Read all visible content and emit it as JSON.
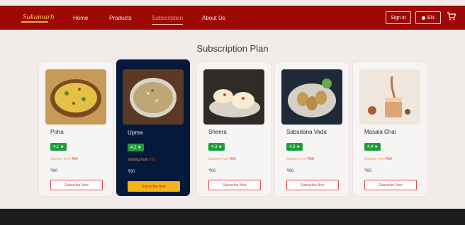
{
  "nav": {
    "logo": "Sukamarh",
    "links": [
      "Home",
      "Products",
      "Subscription",
      "About Us"
    ],
    "signin": "Sign in",
    "lang": "EN"
  },
  "title": "Subscription Plan",
  "plans": [
    {
      "name": "Poha",
      "rating": "4.1 ★",
      "starting": "Starting from",
      "price": "₹50",
      "old": "₹80",
      "button": "Subscribe Now",
      "image": "poha-image"
    },
    {
      "name": "Upma",
      "rating": "4.2 ★",
      "starting": "Starting from",
      "price": "₹58",
      "old": "₹80",
      "button": "Subscribe Now",
      "image": "upma-image"
    },
    {
      "name": "Sheera",
      "rating": "4.3 ★",
      "starting": "Starting from",
      "price": "₹59",
      "old": "₹90",
      "button": "Subscribe Now",
      "image": "sheera-image"
    },
    {
      "name": "Sabudana Vada",
      "rating": "4.3 ★",
      "starting": "Starting from",
      "price": "₹58",
      "old": "₹80",
      "button": "Subscribe Now",
      "image": "sabudana-vada-image"
    },
    {
      "name": "Masala Chai",
      "rating": "4.4 ★",
      "starting": "Starting from",
      "price": "₹59",
      "old": "₹90",
      "button": "Subscribe Now",
      "image": "masala-chai-image"
    }
  ],
  "colors": {
    "nav": "#9d0a06",
    "selected_card": "#07193b",
    "rating": "#1e9b3c",
    "accent_button": "#f1b51a"
  }
}
